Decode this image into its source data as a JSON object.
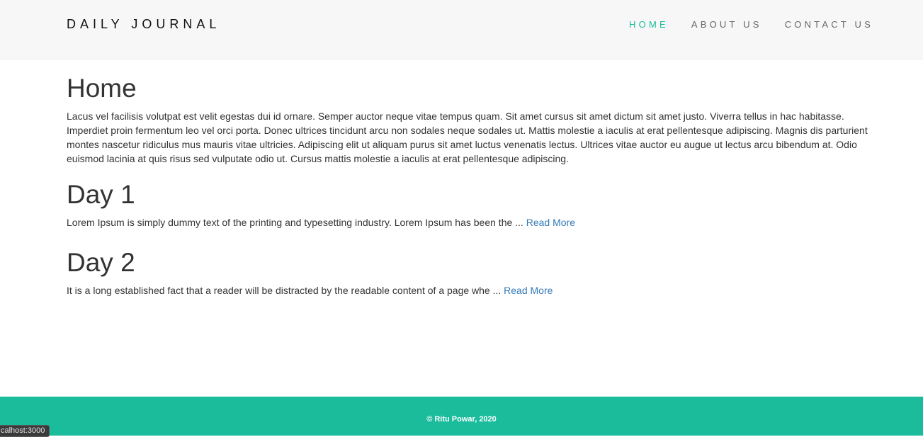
{
  "navbar": {
    "brand": "DAILY JOURNAL",
    "links": [
      {
        "label": "HOME",
        "active": true
      },
      {
        "label": "ABOUT US",
        "active": false
      },
      {
        "label": "CONTACT US",
        "active": false
      }
    ]
  },
  "main": {
    "title": "Home",
    "intro": "Lacus vel facilisis volutpat est velit egestas dui id ornare. Semper auctor neque vitae tempus quam. Sit amet cursus sit amet dictum sit amet justo. Viverra tellus in hac habitasse. Imperdiet proin fermentum leo vel orci porta. Donec ultrices tincidunt arcu non sodales neque sodales ut. Mattis molestie a iaculis at erat pellentesque adipiscing. Magnis dis parturient montes nascetur ridiculus mus mauris vitae ultricies. Adipiscing elit ut aliquam purus sit amet luctus venenatis lectus. Ultrices vitae auctor eu augue ut lectus arcu bibendum at. Odio euismod lacinia at quis risus sed vulputate odio ut. Cursus mattis molestie a iaculis at erat pellentesque adipiscing.",
    "posts": [
      {
        "title": "Day 1",
        "excerpt": "Lorem Ipsum is simply dummy text of the printing and typesetting industry. Lorem Ipsum has been the ... ",
        "read_more": "Read More"
      },
      {
        "title": "Day 2",
        "excerpt": "It is a long established fact that a reader will be distracted by the readable content of a page whe ... ",
        "read_more": "Read More"
      }
    ]
  },
  "footer": {
    "copyright": "© Ritu Powar, 2020"
  },
  "status_bar": {
    "url": "calhost:3000"
  },
  "colors": {
    "accent": "#1abc9c",
    "link": "#337ab7",
    "navbar_bg": "#f7f7f7"
  }
}
